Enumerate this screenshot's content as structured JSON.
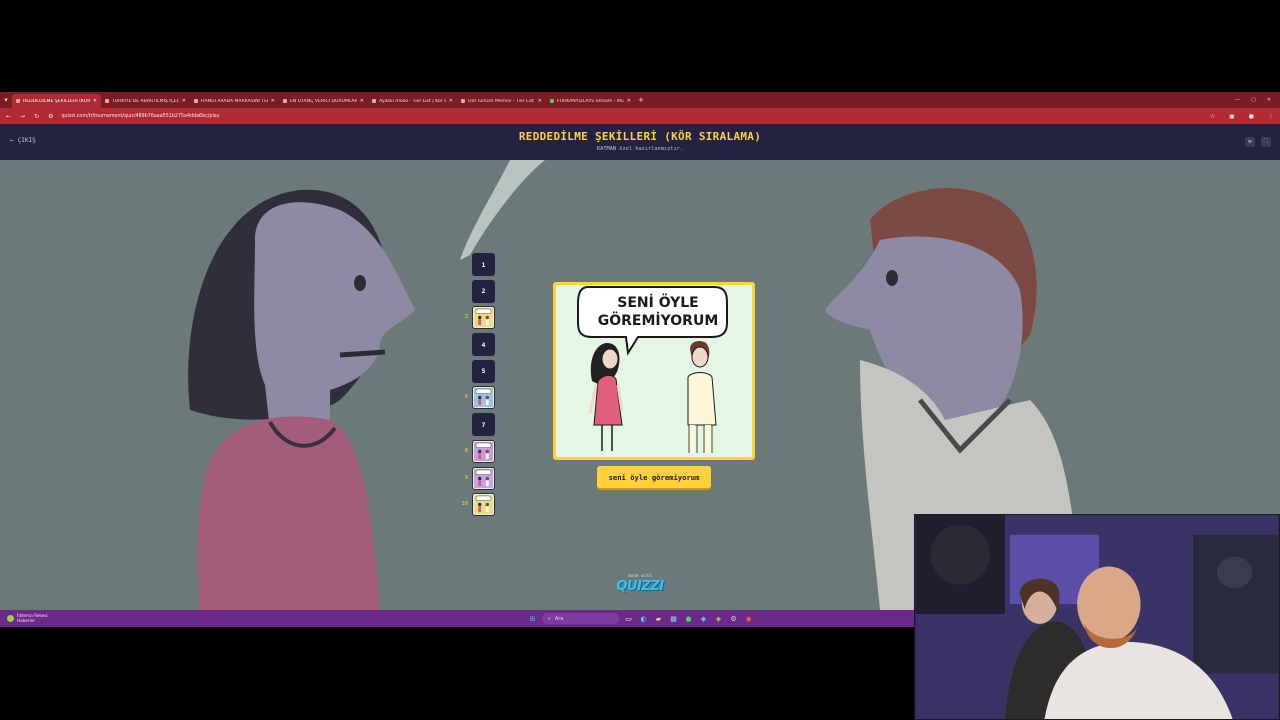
{
  "browser": {
    "tabs": [
      {
        "title": "REDDEDİLME ŞEKİLLERİ (KÖR S",
        "active": true
      },
      {
        "title": "TÜRKİYE'DE ABARTILMIŞ İÇECE",
        "active": false
      },
      {
        "title": "HANGİ ARABA MARKASINI TERC",
        "active": false
      },
      {
        "title": "EN UTANÇ VERİCİ DURUMLAR",
        "active": false
      },
      {
        "title": "Ayakkı moko - Tier List | Kör Sı",
        "active": false
      },
      {
        "title": "Old Turkish Memes - Tier List |",
        "active": false
      },
      {
        "title": "FURKANYIZLAYS Stream - Mus",
        "active": false
      }
    ],
    "url": "quizzi.com/tr/tournament/quiz/489b76aaa551b275a4dda6bc/play"
  },
  "header": {
    "exit_label": "ÇIKIŞ",
    "title": "REDDEDİLME ŞEKİLLERİ (KÖR SIRALAMA)",
    "subtitle": "KATMAN özel hazırlanmıştır."
  },
  "ranks": [
    {
      "number": "1",
      "filled": false
    },
    {
      "number": "2",
      "filled": false
    },
    {
      "number": "3",
      "filled": true,
      "dress": "#f2d98a"
    },
    {
      "number": "4",
      "filled": false
    },
    {
      "number": "5",
      "filled": false
    },
    {
      "number": "6",
      "filled": true,
      "dress": "#9ec3e8"
    },
    {
      "number": "7",
      "filled": false
    },
    {
      "number": "8",
      "filled": true,
      "dress": "#c89be0"
    },
    {
      "number": "9",
      "filled": true,
      "dress": "#c8a2e8"
    },
    {
      "number": "10",
      "filled": true,
      "dress": "#e8de8a"
    }
  ],
  "card": {
    "bubble_text": "SENİ ÖYLE\nGÖREMİYORUM",
    "choice_label": "seni öyle göremiyorum"
  },
  "footer": {
    "made_with": "made with",
    "logo": "QUIZZI"
  },
  "taskbar": {
    "weather_line1": "İddema Rekesi",
    "weather_line2": "Haberler",
    "search_placeholder": "Ara"
  },
  "colors": {
    "accent": "#ffd23a",
    "header_bg": "#232341",
    "tab_bar": "#7a1d22",
    "address_bar": "#b02a33",
    "taskbar": "#6b2a8a"
  }
}
